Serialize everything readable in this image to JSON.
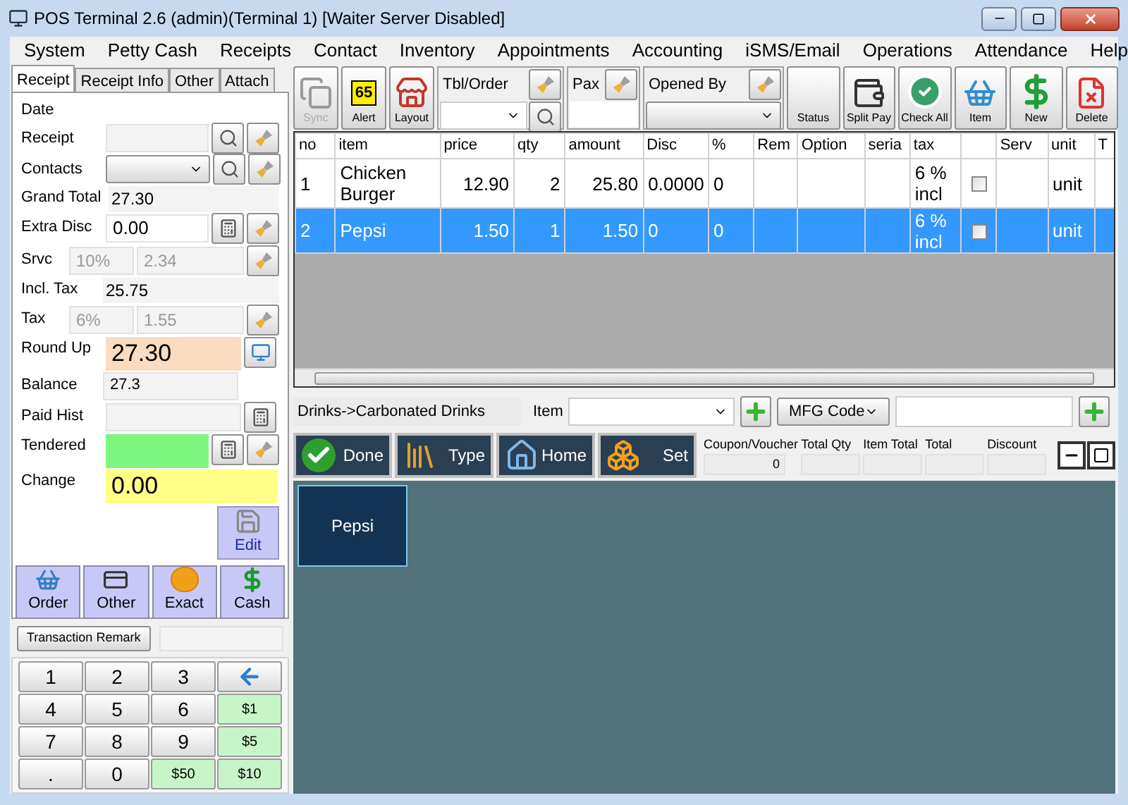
{
  "window": {
    "title": "POS Terminal 2.6 (admin)(Terminal 1) [Waiter Server Disabled]"
  },
  "menu": [
    "System",
    "Petty Cash",
    "Receipts",
    "Contact",
    "Inventory",
    "Appointments",
    "Accounting",
    "iSMS/Email",
    "Operations",
    "Attendance",
    "Help"
  ],
  "left_tabs": [
    {
      "label": "Receipt",
      "selected": true
    },
    {
      "label": "Receipt Info",
      "selected": false
    },
    {
      "label": "Other",
      "selected": false
    },
    {
      "label": "Attach",
      "selected": false
    }
  ],
  "form": {
    "date": {
      "label": "Date"
    },
    "receipt": {
      "label": "Receipt"
    },
    "contacts": {
      "label": "Contacts"
    },
    "grand_total": {
      "label": "Grand Total",
      "value": "27.30"
    },
    "extra_disc": {
      "label": "Extra Disc",
      "value": "0.00"
    },
    "srvc": {
      "label": "Srvc",
      "rate": "10%",
      "value": "2.34"
    },
    "incl_tax": {
      "label": "Incl. Tax",
      "value": "25.75"
    },
    "tax": {
      "label": "Tax",
      "rate": "6%",
      "value": "1.55"
    },
    "round_up": {
      "label": "Round Up",
      "value": "27.30"
    },
    "balance": {
      "label": "Balance",
      "value": "27.3"
    },
    "paid_hist": {
      "label": "Paid Hist"
    },
    "tendered": {
      "label": "Tendered"
    },
    "change": {
      "label": "Change",
      "value": "0.00"
    },
    "edit_button": "Edit",
    "pay_buttons": [
      "Order",
      "Other",
      "Exact",
      "Cash"
    ]
  },
  "transaction_remark": "Transaction Remark",
  "keypad": [
    {
      "kind": "digit",
      "label": "1"
    },
    {
      "kind": "digit",
      "label": "2"
    },
    {
      "kind": "digit",
      "label": "3"
    },
    {
      "kind": "back"
    },
    {
      "kind": "digit",
      "label": "4"
    },
    {
      "kind": "digit",
      "label": "5"
    },
    {
      "kind": "digit",
      "label": "6"
    },
    {
      "kind": "money",
      "label": "$1"
    },
    {
      "kind": "digit",
      "label": "7"
    },
    {
      "kind": "digit",
      "label": "8"
    },
    {
      "kind": "digit",
      "label": "9"
    },
    {
      "kind": "money",
      "label": "$5"
    },
    {
      "kind": "digit",
      "label": "."
    },
    {
      "kind": "digit",
      "label": "0"
    },
    {
      "kind": "money",
      "label": "$50"
    },
    {
      "kind": "money",
      "label": "$10"
    }
  ],
  "toolbar": {
    "left_buttons": [
      {
        "label": "Sync",
        "disabled": true
      },
      {
        "label": "Alert",
        "badge": "65",
        "disabled": false
      },
      {
        "label": "Layout",
        "disabled": false
      }
    ],
    "tbl_order": {
      "label": "Tbl/Order"
    },
    "pax": {
      "label": "Pax"
    },
    "opened_by": {
      "label": "Opened By"
    },
    "right_buttons": [
      "Status",
      "Split Pay",
      "Check All",
      "Item",
      "New",
      "Delete"
    ]
  },
  "table": {
    "columns": [
      {
        "label": "no",
        "kind": "text"
      },
      {
        "label": "item",
        "kind": "text"
      },
      {
        "label": "price",
        "kind": "number"
      },
      {
        "label": "qty",
        "kind": "number"
      },
      {
        "label": "amount",
        "kind": "number"
      },
      {
        "label": "Disc",
        "kind": "text"
      },
      {
        "label": "%",
        "kind": "text"
      },
      {
        "label": "Rem",
        "kind": "blank"
      },
      {
        "label": "Option",
        "kind": "blank"
      },
      {
        "label": "seria",
        "kind": "blank"
      },
      {
        "label": "tax",
        "kind": "text"
      },
      {
        "kind": "check"
      },
      {
        "label": "Serv",
        "kind": "blank"
      },
      {
        "label": "unit",
        "kind": "text"
      },
      {
        "label": "T",
        "kind": "blank"
      }
    ],
    "rows": [
      {
        "values": [
          "1",
          "Chicken Burger",
          "12.90",
          "2",
          "25.80",
          "0.0000",
          "0",
          "6 % incl",
          "unit"
        ],
        "checked": false,
        "selected": false
      },
      {
        "values": [
          "2",
          "Pepsi",
          "1.50",
          "1",
          "1.50",
          "0",
          "0",
          "6 % incl",
          "unit"
        ],
        "checked": false,
        "selected": true
      }
    ]
  },
  "category_path": "Drinks->Carbonated Drinks",
  "item_label": "Item",
  "code_select": "MFG Code",
  "actions": [
    "Done",
    "Type",
    "Home",
    "Set"
  ],
  "totals": [
    {
      "label": "Coupon/Voucher",
      "value": "0"
    },
    {
      "label": "Total Qty"
    },
    {
      "label": "Item Total"
    },
    {
      "label": "Total"
    },
    {
      "label": "Discount"
    }
  ],
  "tiles": [
    {
      "label": "Pepsi"
    }
  ]
}
